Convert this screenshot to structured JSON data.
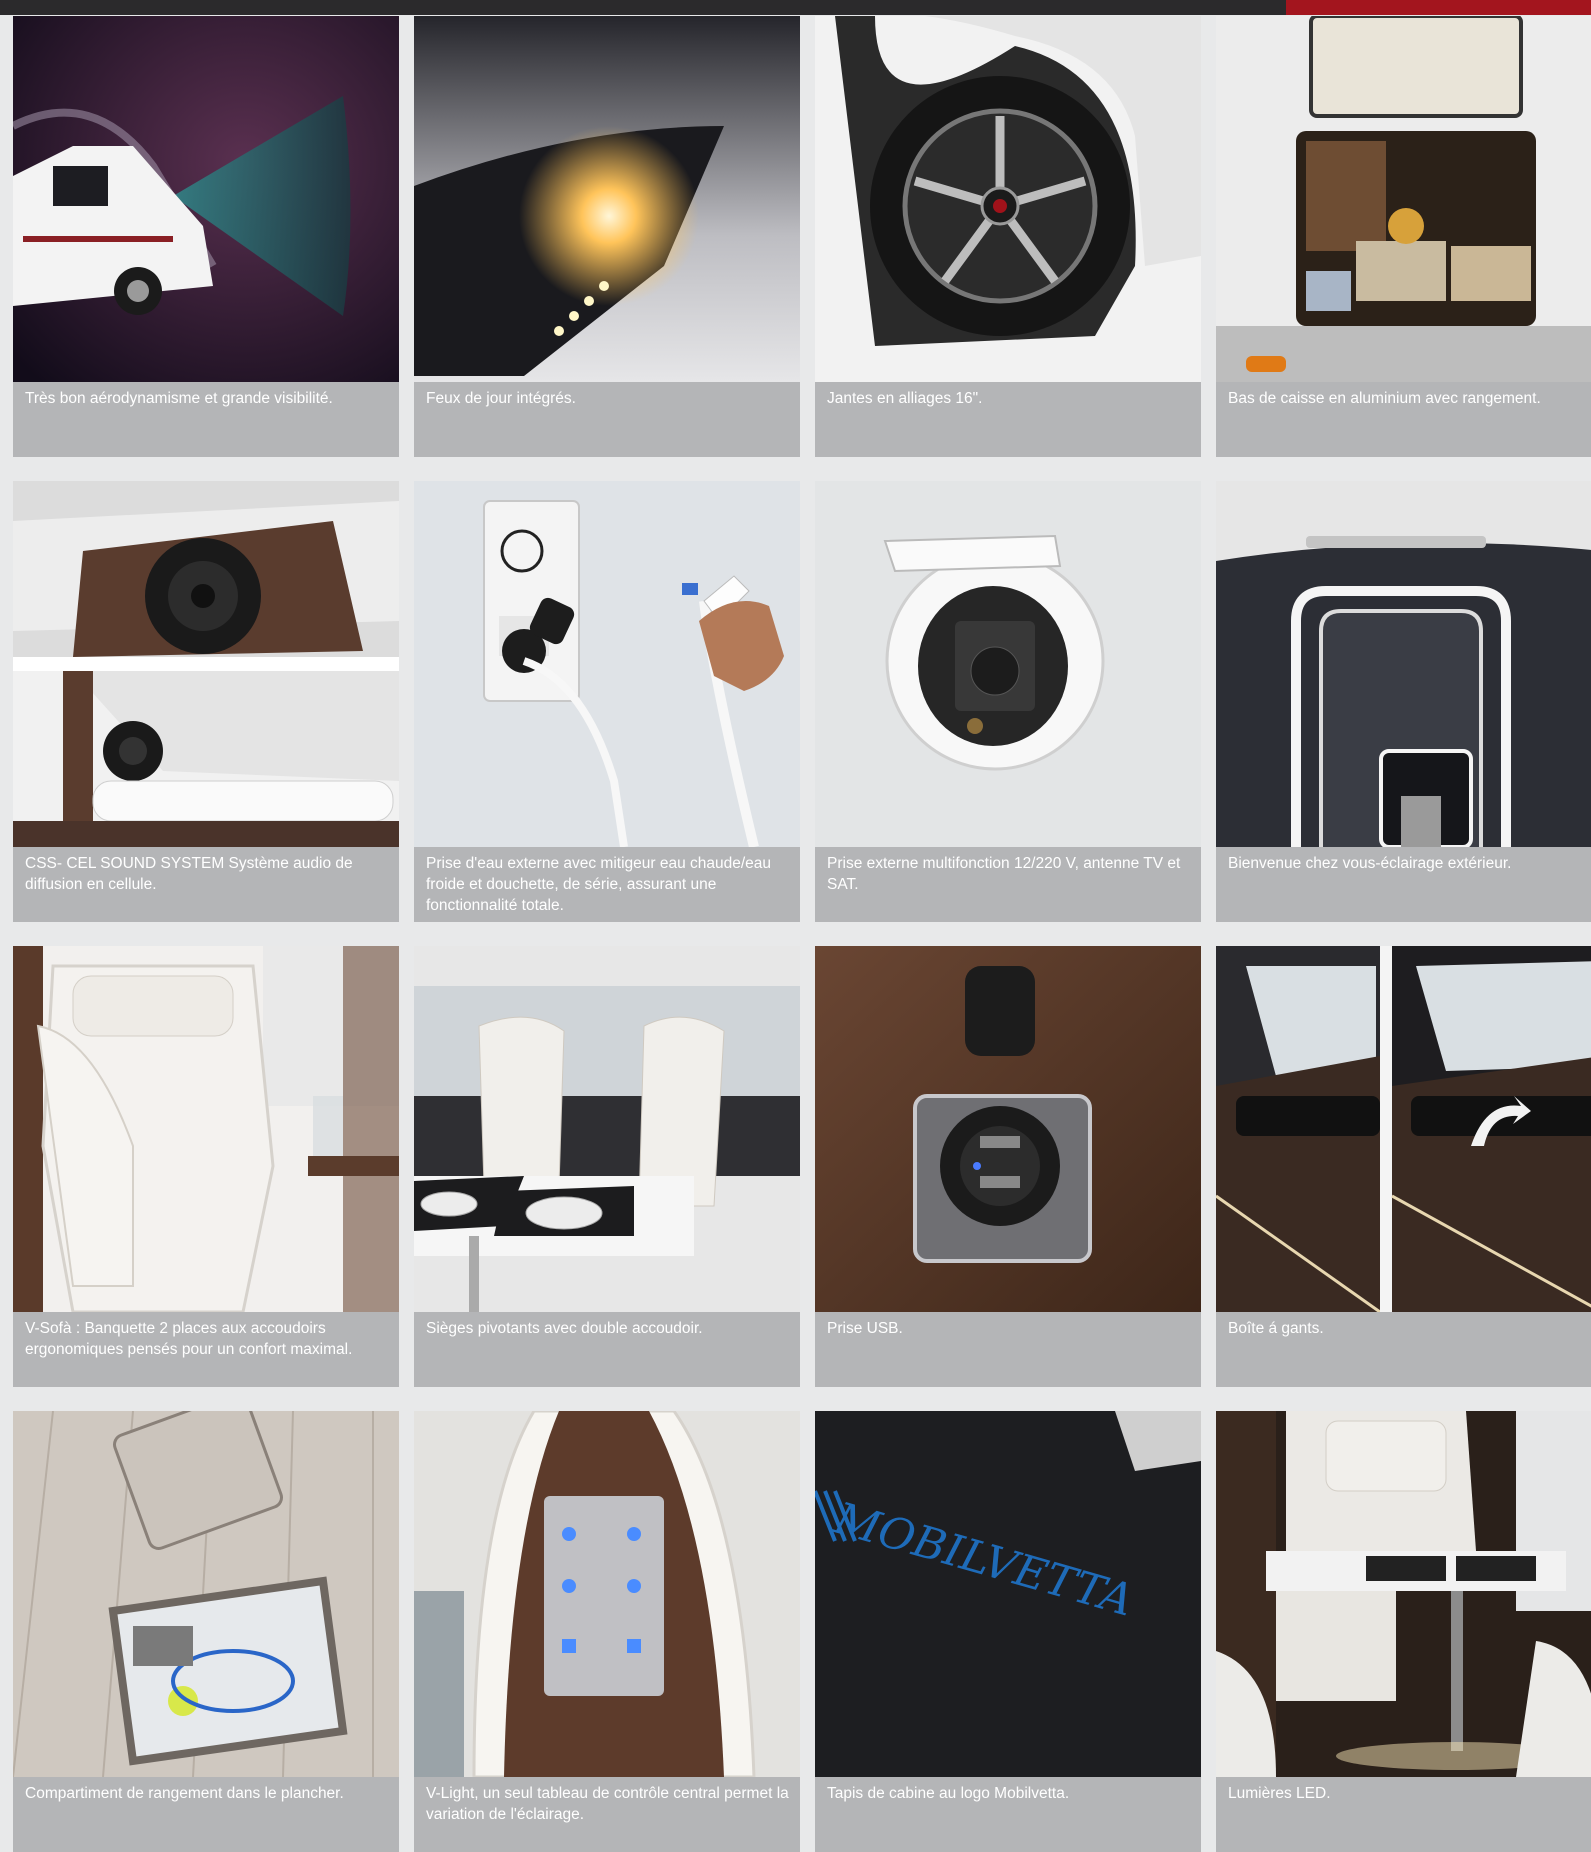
{
  "cards": [
    {
      "caption": "Très bon aérodynamisme et grande visibilité."
    },
    {
      "caption": "Feux de jour intégrés."
    },
    {
      "caption": "Jantes en alliages 16\"."
    },
    {
      "caption": "Bas de caisse en aluminium avec rangement."
    },
    {
      "caption": "CSS- CEL SOUND SYSTEM Système audio de diffusion en cellule."
    },
    {
      "caption": "Prise d'eau externe avec mitigeur eau chaude/eau froide et douchette, de série, assurant une fonctionnalité totale."
    },
    {
      "caption": "Prise externe multifonction 12/220 V, antenne TV et SAT."
    },
    {
      "caption": "Bienvenue chez vous-éclairage extérieur."
    },
    {
      "caption": "V-Sofà : Banquette 2 places aux accoudoirs ergonomiques pensés pour un confort maximal."
    },
    {
      "caption": "Sièges pivotants avec double accoudoir."
    },
    {
      "caption": "Prise USB."
    },
    {
      "caption": "Boîte á gants."
    },
    {
      "caption": "Compartiment de rangement dans le plancher."
    },
    {
      "caption": "V-Light, un seul tableau de contrôle central permet la variation de l'éclairage."
    },
    {
      "caption": "Tapis de cabine au logo Mobilvetta."
    },
    {
      "caption": "Lumières LED."
    }
  ],
  "logo_text": "MOBILVETTA",
  "colors": {
    "top_bar": "#2b2a2c",
    "top_bar_accent": "#a3151e",
    "caption_bg": "#b4b5b7",
    "caption_text": "#ffffff",
    "page_bg": "#e8e9ea"
  }
}
